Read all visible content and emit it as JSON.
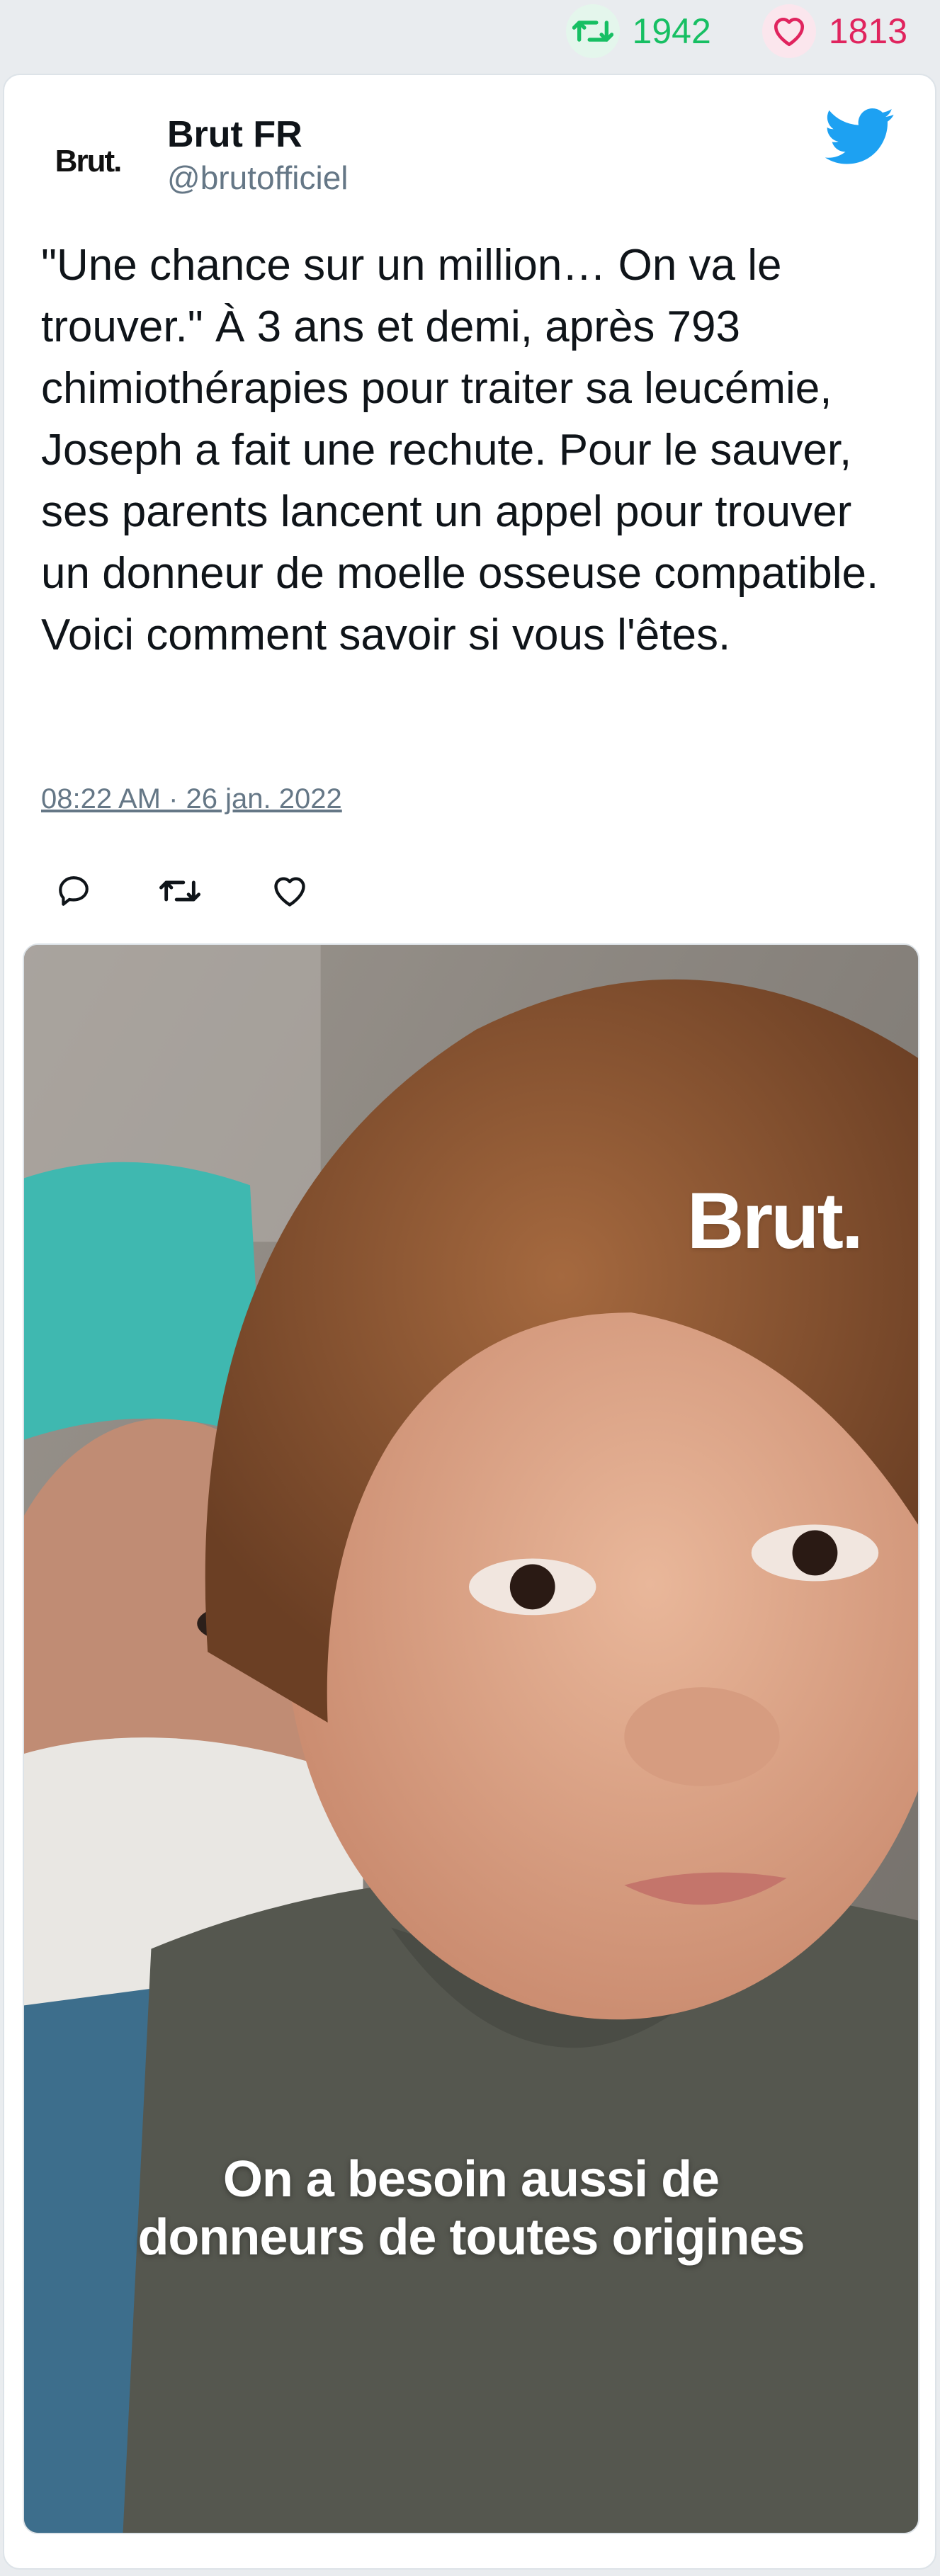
{
  "stats": {
    "retweets": "1942",
    "likes": "1813",
    "retweet_icon": "retweet-icon",
    "like_icon": "heart-icon"
  },
  "author": {
    "display_name": "Brut FR",
    "handle": "@brutofficiel",
    "avatar_text": "Brut."
  },
  "tweet": {
    "text": "\"Une chance sur un million… On va le trouver.\" À 3 ans et demi, après 793 chimiothérapies pour traiter sa leucémie, Joseph a fait une rechute. Pour le sauver, ses parents lancent un appel pour trouver un donneur de moelle osseuse compatible. Voici comment savoir si vous l'êtes.",
    "timestamp": "08:22 AM · 26 jan. 2022"
  },
  "actions": [
    "reply-icon",
    "retweet-icon",
    "heart-icon"
  ],
  "media": {
    "brand_text": "Brut.",
    "caption_line1": "On a besoin aussi de",
    "caption_line2": "donneurs de toutes origines"
  },
  "colors": {
    "retweet": "#17bf63",
    "like": "#e0245e",
    "twitter_blue": "#1da1f2",
    "muted": "#657786"
  }
}
